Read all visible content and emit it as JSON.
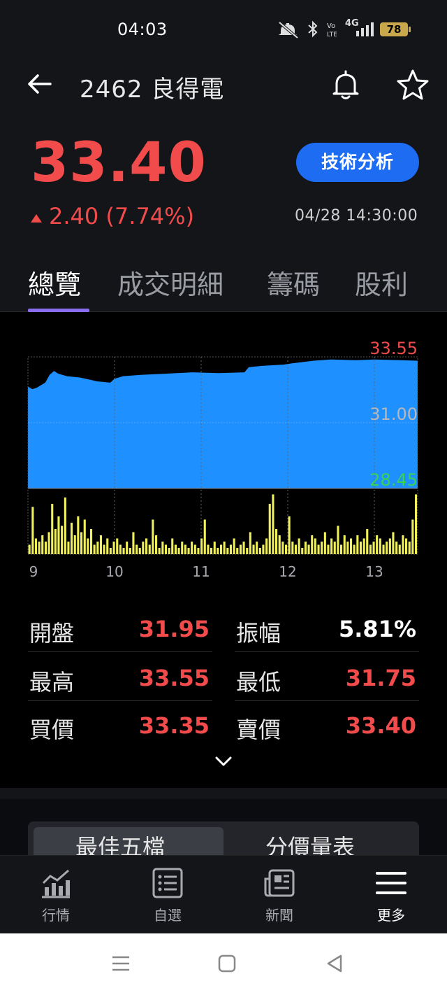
{
  "status_bar": {
    "time": "04:03",
    "battery": "78",
    "signal_text": "4G"
  },
  "header": {
    "title": "2462 良得電"
  },
  "quote": {
    "price": "33.40",
    "change": "2.40 (7.74%)",
    "datetime": "04/28 14:30:00",
    "tech_button": "技術分析"
  },
  "tabs": [
    {
      "label": "總覽",
      "active": true
    },
    {
      "label": "成交明細",
      "active": false
    },
    {
      "label": "籌碼",
      "active": false
    },
    {
      "label": "股利",
      "active": false
    }
  ],
  "chart_data": {
    "type": "area",
    "y_labels": {
      "high": "33.55",
      "mid": "31.00",
      "low": "28.45"
    },
    "ylim": [
      28.45,
      33.55
    ],
    "x_ticks": [
      "9",
      "10",
      "11",
      "12",
      "13"
    ],
    "price_series": [
      [
        9.0,
        32.4
      ],
      [
        9.05,
        32.3
      ],
      [
        9.1,
        32.35
      ],
      [
        9.15,
        32.45
      ],
      [
        9.2,
        32.55
      ],
      [
        9.25,
        32.85
      ],
      [
        9.3,
        33.0
      ],
      [
        9.35,
        32.9
      ],
      [
        9.45,
        32.8
      ],
      [
        9.6,
        32.75
      ],
      [
        9.8,
        32.6
      ],
      [
        9.95,
        32.55
      ],
      [
        10.0,
        32.7
      ],
      [
        10.1,
        32.8
      ],
      [
        10.3,
        32.85
      ],
      [
        10.6,
        32.9
      ],
      [
        10.9,
        32.95
      ],
      [
        11.2,
        32.92
      ],
      [
        11.5,
        32.95
      ],
      [
        11.55,
        33.15
      ],
      [
        11.7,
        33.2
      ],
      [
        11.95,
        33.25
      ],
      [
        12.05,
        33.3
      ],
      [
        12.3,
        33.4
      ],
      [
        12.5,
        33.45
      ],
      [
        12.8,
        33.42
      ],
      [
        13.0,
        33.45
      ],
      [
        13.3,
        33.42
      ],
      [
        13.5,
        33.4
      ]
    ],
    "volume_series": [
      0.15,
      0.75,
      0.25,
      0.2,
      0.3,
      0.2,
      0.35,
      0.8,
      0.4,
      0.6,
      0.45,
      0.9,
      0.2,
      0.5,
      0.3,
      0.6,
      0.35,
      0.55,
      0.25,
      0.4,
      0.15,
      0.2,
      0.3,
      0.15,
      0.25,
      0.1,
      0.2,
      0.25,
      0.15,
      0.1,
      0.2,
      0.1,
      0.35,
      0.15,
      0.1,
      0.2,
      0.25,
      0.15,
      0.55,
      0.3,
      0.1,
      0.2,
      0.15,
      0.1,
      0.25,
      0.15,
      0.1,
      0.2,
      0.15,
      0.1,
      0.2,
      0.15,
      0.1,
      0.25,
      0.55,
      0.15,
      0.1,
      0.2,
      0.1,
      0.15,
      0.2,
      0.1,
      0.15,
      0.25,
      0.1,
      0.15,
      0.2,
      0.1,
      0.35,
      0.15,
      0.2,
      0.1,
      0.15,
      0.25,
      0.8,
      0.95,
      0.4,
      0.3,
      0.2,
      0.15,
      0.6,
      0.2,
      0.15,
      0.25,
      0.1,
      0.2,
      0.15,
      0.3,
      0.25,
      0.15,
      0.2,
      0.35,
      0.15,
      0.25,
      0.2,
      0.45,
      0.15,
      0.3,
      0.2,
      0.25,
      0.15,
      0.3,
      0.2,
      0.25,
      0.4,
      0.15,
      0.2,
      0.3,
      0.25,
      0.15,
      0.2,
      0.25,
      0.35,
      0.2,
      0.15,
      0.3,
      0.25,
      0.2,
      0.55,
      0.95
    ],
    "colors": {
      "area": "#1e90ff",
      "volume": "#f0f05a",
      "high_label": "#f24b4b",
      "mid_label": "#b8b8b8",
      "low_label": "#39d353"
    }
  },
  "stats": {
    "open_label": "開盤",
    "open": "31.95",
    "amp_label": "振幅",
    "amp": "5.81%",
    "high_label": "最高",
    "high": "33.55",
    "low_label": "最低",
    "low": "31.75",
    "bid_label": "買價",
    "bid": "33.35",
    "ask_label": "賣價",
    "ask": "33.40"
  },
  "lower": {
    "seg_a": "最佳五檔",
    "seg_b": "分價量表"
  },
  "nav": [
    {
      "label": "行情",
      "icon": "chart-icon"
    },
    {
      "label": "自選",
      "icon": "list-icon"
    },
    {
      "label": "新聞",
      "icon": "news-icon"
    },
    {
      "label": "更多",
      "icon": "menu-icon"
    }
  ],
  "colors": {
    "up": "#f24b4b",
    "accent": "#1e6cf2",
    "tab_underline": "#8a6cf0"
  }
}
